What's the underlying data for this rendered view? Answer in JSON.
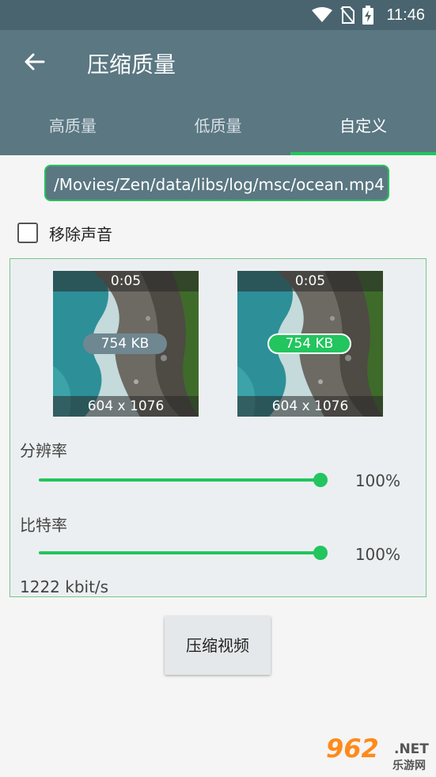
{
  "status_bar": {
    "time": "11:46",
    "icons": [
      "wifi-icon",
      "no-sim-icon",
      "battery-charging-icon"
    ]
  },
  "app_bar": {
    "back_icon": "arrow-left-icon",
    "title": "压缩质量"
  },
  "tabs": [
    {
      "label": "高质量",
      "active": false
    },
    {
      "label": "低质量",
      "active": false
    },
    {
      "label": "自定义",
      "active": true
    }
  ],
  "file_path": "/Movies/Zen/data/libs/log/msc/ocean.mp4",
  "remove_audio": {
    "label": "移除声音",
    "checked": false
  },
  "preview": {
    "original": {
      "duration": "0:05",
      "size": "754 KB",
      "resolution": "604 x 1076"
    },
    "compressed": {
      "duration": "0:05",
      "size": "754 KB",
      "resolution": "604 x 1076"
    }
  },
  "resolution": {
    "label": "分辨率",
    "value_percent": 100,
    "value_text": "100%"
  },
  "bitrate": {
    "label": "比特率",
    "value_percent": 100,
    "value_text": "100%",
    "kbps_text": "1222 kbit/s"
  },
  "compress_button": "压缩视频",
  "watermark": {
    "logo": "962",
    "suffix": ".NET",
    "site": "乐游网"
  },
  "colors": {
    "primary": "#5a7782",
    "status_bar": "#49646f",
    "accent": "#22c55e",
    "background": "#f5f5f5",
    "panel": "#eceff1"
  }
}
